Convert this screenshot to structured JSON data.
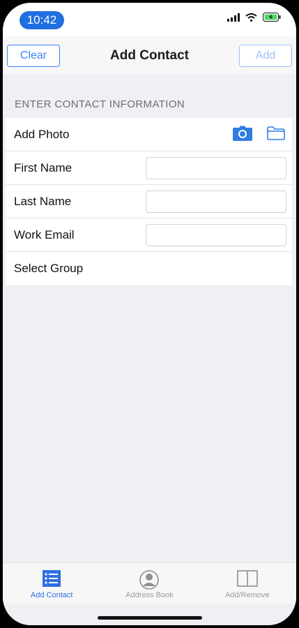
{
  "status_bar": {
    "time": "10:42",
    "icons": [
      "signal-icon",
      "wifi-icon",
      "battery-icon"
    ],
    "accent": "#1f6fe0"
  },
  "nav": {
    "clear_label": "Clear",
    "title": "Add Contact",
    "add_label": "Add"
  },
  "form": {
    "section_header": "ENTER CONTACT INFORMATION",
    "add_photo_label": "Add Photo",
    "photo_icons": [
      "camera-icon",
      "folder-icon"
    ],
    "first_name": {
      "label": "First Name",
      "value": ""
    },
    "last_name": {
      "label": "Last Name",
      "value": ""
    },
    "work_email": {
      "label": "Work Email",
      "value": ""
    },
    "select_group_label": "Select Group"
  },
  "tabs": [
    {
      "label": "Add Contact",
      "icon": "list-icon",
      "active": true
    },
    {
      "label": "Address Book",
      "icon": "person-icon",
      "active": false
    },
    {
      "label": "Add/Remove",
      "icon": "book-icon",
      "active": false
    }
  ],
  "colors": {
    "primary": "#3b82f6",
    "disabled": "#9ec2f2",
    "background": "#efeff4"
  }
}
